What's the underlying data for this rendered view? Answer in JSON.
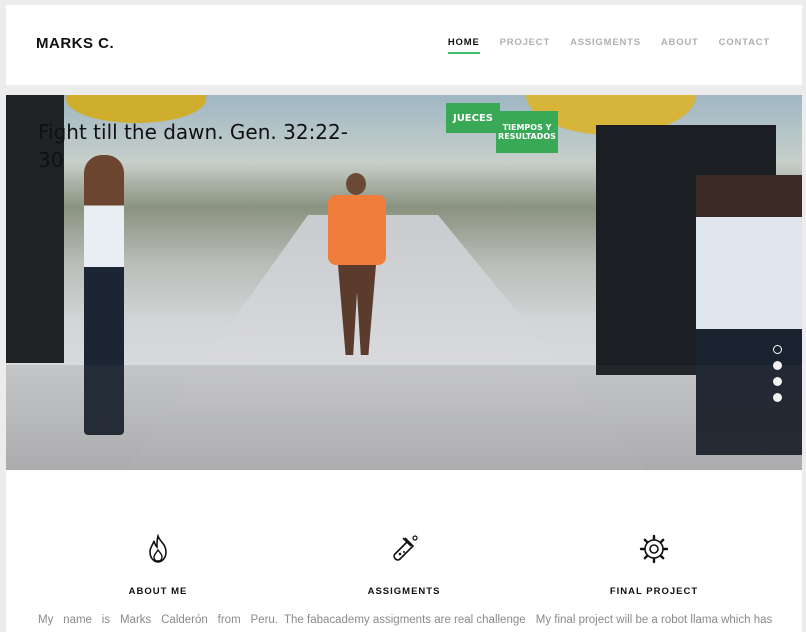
{
  "header": {
    "brand": "MARKS C.",
    "nav": [
      {
        "label": "HOME",
        "active": true
      },
      {
        "label": "PROJECT",
        "active": false
      },
      {
        "label": "ASSIGMENTS",
        "active": false
      },
      {
        "label": "ABOUT",
        "active": false
      },
      {
        "label": "CONTACT",
        "active": false
      }
    ],
    "accent_color": "#3bbf6a"
  },
  "hero": {
    "caption": "Fight till the dawn. Gen. 32:22-30",
    "sign_1": "JUECES",
    "sign_2": "TIEMPOS Y RESULTADOS",
    "slider_dots": 4,
    "active_dot": 1
  },
  "features": [
    {
      "icon": "flame-icon",
      "title": "ABOUT ME",
      "text": "My name is Marks Calderón from Peru."
    },
    {
      "icon": "flask-icon",
      "title": "ASSIGMENTS",
      "text": "The fabacademy assigments are real challenge"
    },
    {
      "icon": "gear-icon",
      "title": "FINAL PROJECT",
      "text": "My final project will be a robot llama which has"
    }
  ]
}
